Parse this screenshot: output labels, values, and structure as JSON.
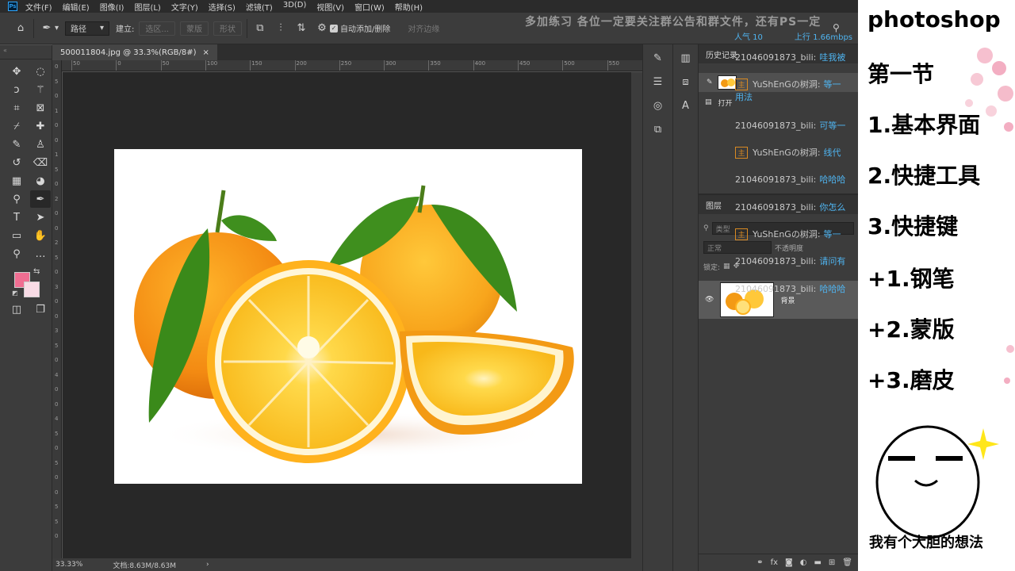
{
  "app": {
    "logo_text": "Ps"
  },
  "menu": [
    "文件(F)",
    "编辑(E)",
    "图像(I)",
    "图层(L)",
    "文字(Y)",
    "选择(S)",
    "滤镜(T)",
    "3D(D)",
    "视图(V)",
    "窗口(W)",
    "帮助(H)"
  ],
  "banner": "多加练习 各位一定要关注群公告和群文件，还有PS一定",
  "options": {
    "mode_select": "路径",
    "make_label": "建立:",
    "selection_btn": "选区...",
    "mask_btn": "蒙版",
    "shape_btn": "形状",
    "auto_add_label": "自动添加/删除",
    "align_edges_label": "对齐边缘"
  },
  "document": {
    "tab_label": "500011804.jpg @ 33.3%(RGB/8#)",
    "close_glyph": "×",
    "zoom": "33.33%",
    "doc_size": "文档:8.63M/8.63M",
    "status_arrow": "›"
  },
  "rulers": {
    "top": [
      "50",
      "0",
      "50",
      "100",
      "150",
      "200",
      "250",
      "300",
      "350",
      "400",
      "450",
      "500",
      "550",
      "600",
      "650",
      "700",
      "750",
      "800",
      "850",
      "900",
      "950",
      "1000",
      "1050",
      "1100",
      "1150"
    ],
    "left": [
      "0",
      "5",
      "0",
      "1",
      "0",
      "0",
      "1",
      "5",
      "0",
      "2",
      "0",
      "0",
      "2",
      "5",
      "0",
      "3",
      "0",
      "0",
      "3",
      "5",
      "0",
      "4",
      "0",
      "0",
      "4",
      "5",
      "0",
      "5",
      "0",
      "0",
      "5",
      "5",
      "0"
    ]
  },
  "tools": [
    {
      "name": "move-tool-icon",
      "glyph": "✥"
    },
    {
      "name": "marquee-tool-icon",
      "glyph": "◌"
    },
    {
      "name": "lasso-tool-icon",
      "glyph": "ↄ"
    },
    {
      "name": "magic-wand-icon",
      "glyph": "⚚"
    },
    {
      "name": "crop-tool-icon",
      "glyph": "⌗"
    },
    {
      "name": "frame-tool-icon",
      "glyph": "⊠"
    },
    {
      "name": "eyedropper-icon",
      "glyph": "⌿"
    },
    {
      "name": "healing-brush-icon",
      "glyph": "✚"
    },
    {
      "name": "brush-tool-icon",
      "glyph": "✎"
    },
    {
      "name": "stamp-tool-icon",
      "glyph": "♙"
    },
    {
      "name": "history-brush-icon",
      "glyph": "↺"
    },
    {
      "name": "eraser-tool-icon",
      "glyph": "⌫"
    },
    {
      "name": "gradient-tool-icon",
      "glyph": "▦"
    },
    {
      "name": "blur-tool-icon",
      "glyph": "◕"
    },
    {
      "name": "dodge-tool-icon",
      "glyph": "⚲"
    },
    {
      "name": "pen-tool-icon",
      "glyph": "✒"
    },
    {
      "name": "type-tool-icon",
      "glyph": "T"
    },
    {
      "name": "path-selection-icon",
      "glyph": "➤"
    },
    {
      "name": "shape-tool-icon",
      "glyph": "▭"
    },
    {
      "name": "hand-tool-icon",
      "glyph": "✋"
    },
    {
      "name": "zoom-tool-icon",
      "glyph": "⚲"
    },
    {
      "name": "more-tools-icon",
      "glyph": "…"
    }
  ],
  "colors": {
    "foreground": "#f06e92",
    "background": "#f8dbe5",
    "accent_blue": "#4fb4f0",
    "badge_orange": "#d98a22"
  },
  "bottom_tools": [
    {
      "name": "quick-mask-icon",
      "glyph": "◫"
    },
    {
      "name": "screen-mode-icon",
      "glyph": "❐"
    }
  ],
  "strip_icons": [
    {
      "name": "brush-settings-icon",
      "glyph": "✎"
    },
    {
      "name": "adjust-icon",
      "glyph": "☰"
    },
    {
      "name": "color-wheel-icon",
      "glyph": "◎"
    },
    {
      "name": "3d-icon",
      "glyph": "⧉"
    }
  ],
  "strip_icons2": [
    {
      "name": "histogram-icon",
      "glyph": "▥"
    },
    {
      "name": "properties-icon",
      "glyph": "⧈"
    },
    {
      "name": "character-icon",
      "glyph": "A"
    }
  ],
  "history": {
    "tab": "历史记录",
    "open_label": "打开"
  },
  "layers": {
    "tab": "图层",
    "kind_placeholder": "类型",
    "blend_mode": "正常",
    "opacity_label": "不透明度",
    "lock_label": "锁定:",
    "bg_layer_name": "背景"
  },
  "stream": {
    "viewers": "人气 10",
    "upload": "上行 1.66mbps"
  },
  "chat": [
    {
      "user": "21046091873_bili:",
      "msg": "哇我被",
      "badge": ""
    },
    {
      "user": "YuShEnGの树洞:",
      "msg": "等一",
      "badge": "主"
    },
    {
      "user": "用法",
      "msg": "",
      "badge": ""
    },
    {
      "user": "21046091873_bili:",
      "msg": "可等一",
      "badge": ""
    },
    {
      "user": "YuShEnGの树洞:",
      "msg": "线代",
      "badge": "主"
    },
    {
      "user": "21046091873_bili:",
      "msg": "哈哈哈",
      "badge": ""
    },
    {
      "user": "21046091873_bili:",
      "msg": "你怎么",
      "badge": ""
    },
    {
      "user": "YuShEnGの树洞:",
      "msg": "等一",
      "badge": "主"
    },
    {
      "user": "21046091873_bili:",
      "msg": "请问有",
      "badge": ""
    },
    {
      "user": "21046091873_bili:",
      "msg": "哈哈哈",
      "badge": ""
    }
  ],
  "slide": {
    "title": "photoshop",
    "lines": [
      "第一节",
      "1.基本界面",
      "2.快捷工具",
      "3.快捷键",
      "+1.钢笔",
      "+2.蒙版",
      "+3.磨皮"
    ],
    "meme_caption": "我有个大胆的想法"
  }
}
